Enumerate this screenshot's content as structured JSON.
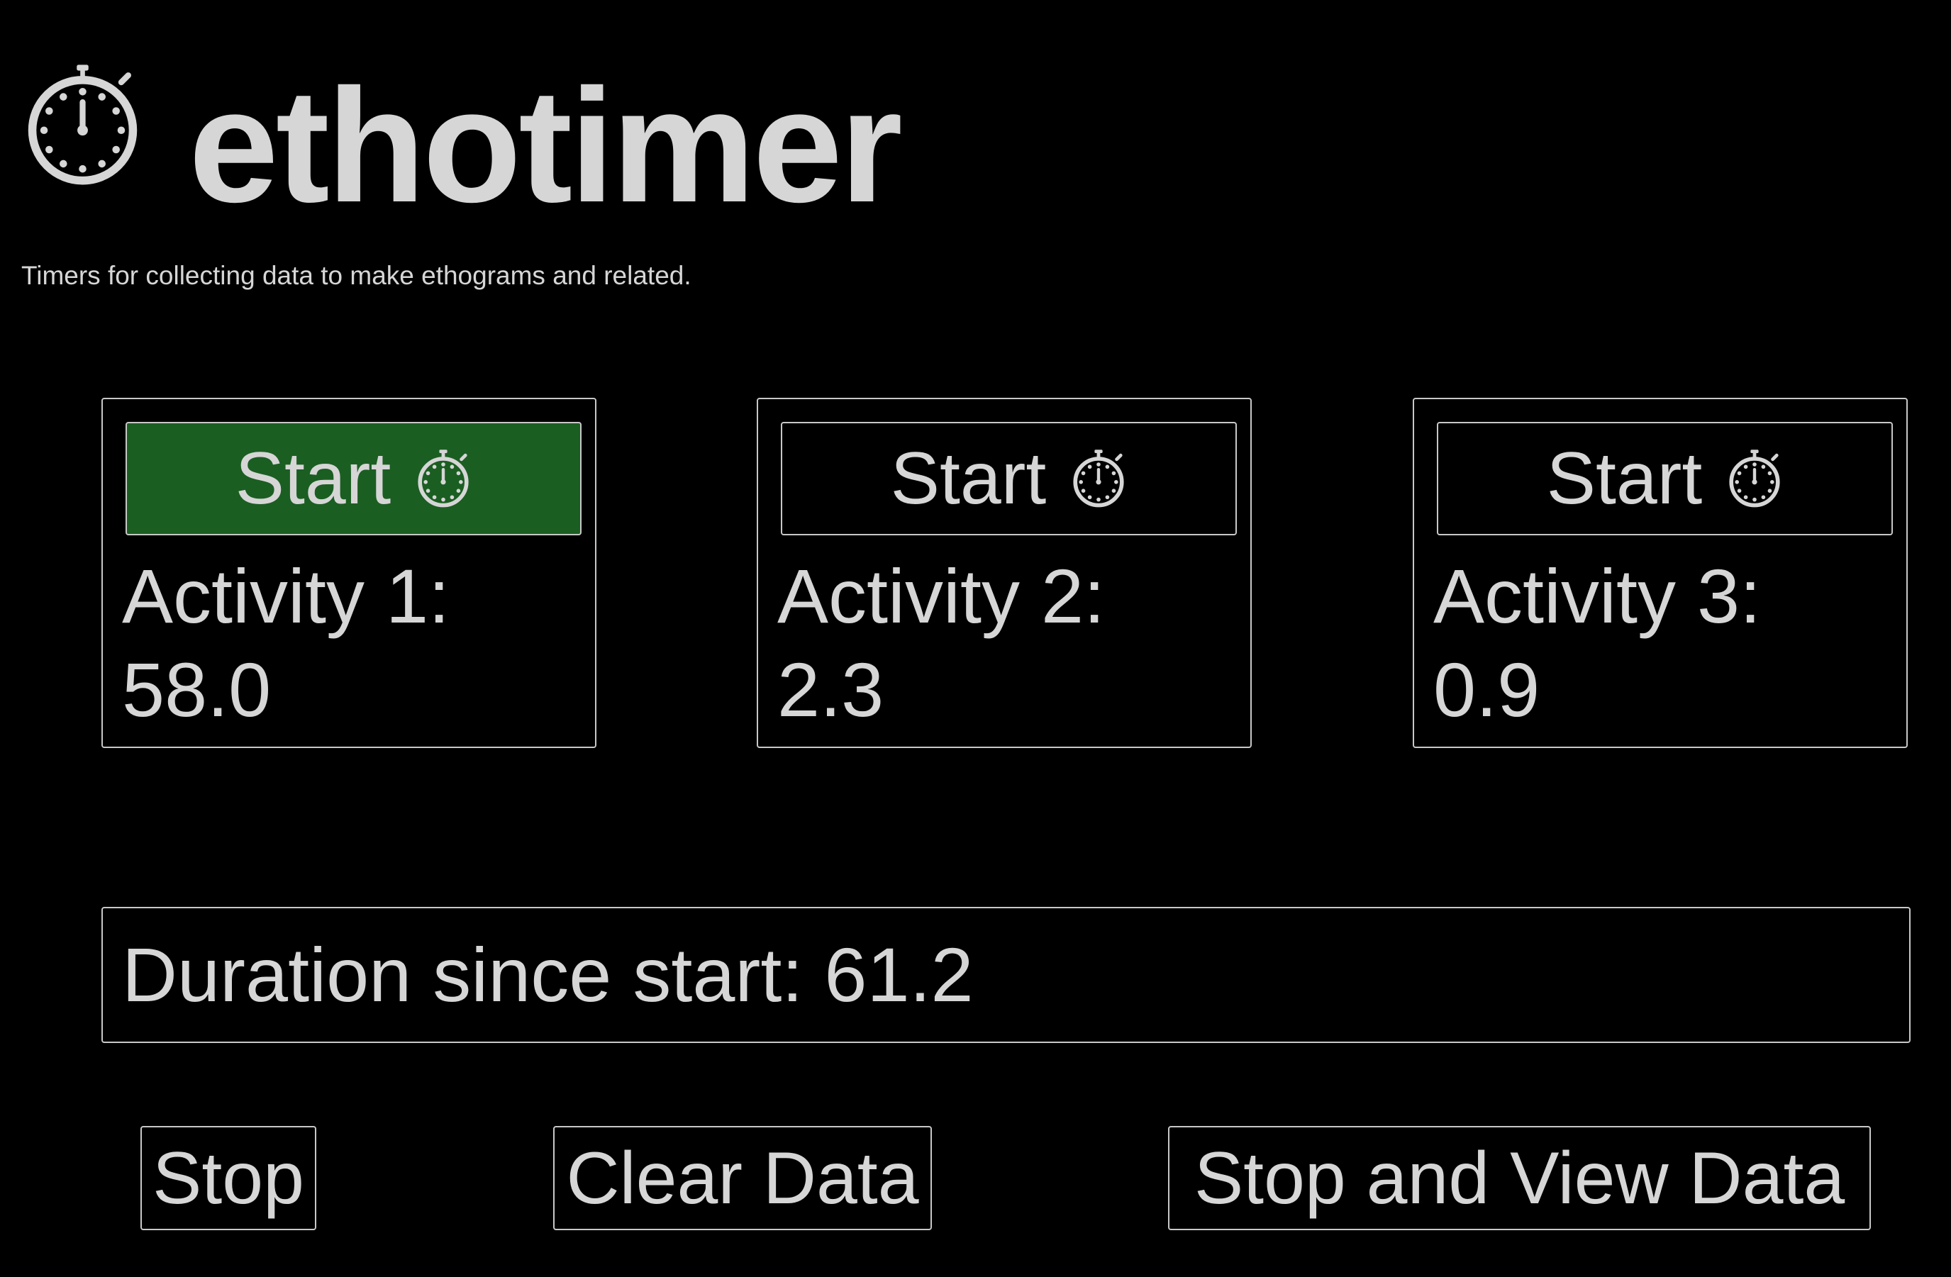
{
  "app": {
    "title": "ethotimer",
    "subtitle": "Timers for collecting data to make ethograms and related.",
    "logo_icon": "stopwatch-icon"
  },
  "colors": {
    "background": "#000000",
    "text": "#d6d6d6",
    "border": "#c8c8c8",
    "active_button": "#1b5e22"
  },
  "activities": [
    {
      "button_label": "Start",
      "button_icon": "stopwatch-icon",
      "label": "Activity 1:",
      "value": "58.0",
      "active": true
    },
    {
      "button_label": "Start",
      "button_icon": "stopwatch-icon",
      "label": "Activity 2:",
      "value": "2.3",
      "active": false
    },
    {
      "button_label": "Start",
      "button_icon": "stopwatch-icon",
      "label": "Activity 3:",
      "value": "0.9",
      "active": false
    }
  ],
  "duration": {
    "label": "Duration since start:",
    "value": "61.2"
  },
  "actions": {
    "stop": "Stop",
    "clear": "Clear Data",
    "stop_and_view": "Stop and View Data"
  }
}
